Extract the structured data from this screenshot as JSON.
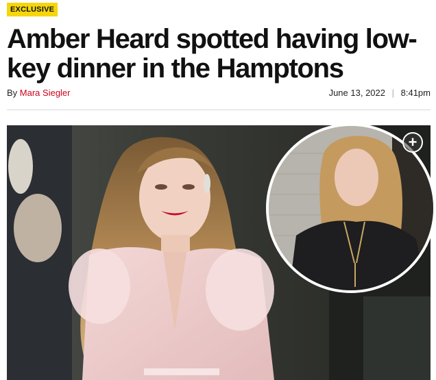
{
  "article": {
    "badge": "EXCLUSIVE",
    "headline": "Amber Heard spotted having low-key dinner in the Hamptons",
    "byline_prefix": "By",
    "author": "Mara Siegler",
    "date": "June 13, 2022",
    "date_separator": "|",
    "time": "8:41pm"
  },
  "media": {
    "main_photo": "photo-amber-heard-pink-gown",
    "inset_photo": "photo-amber-heard-black-sweater",
    "expand_icon": "plus-circle-icon",
    "expand_symbol": "+"
  },
  "colors": {
    "badge_bg": "#f5d60a",
    "author_link": "#d0021b",
    "divider": "#d9d9d9"
  }
}
